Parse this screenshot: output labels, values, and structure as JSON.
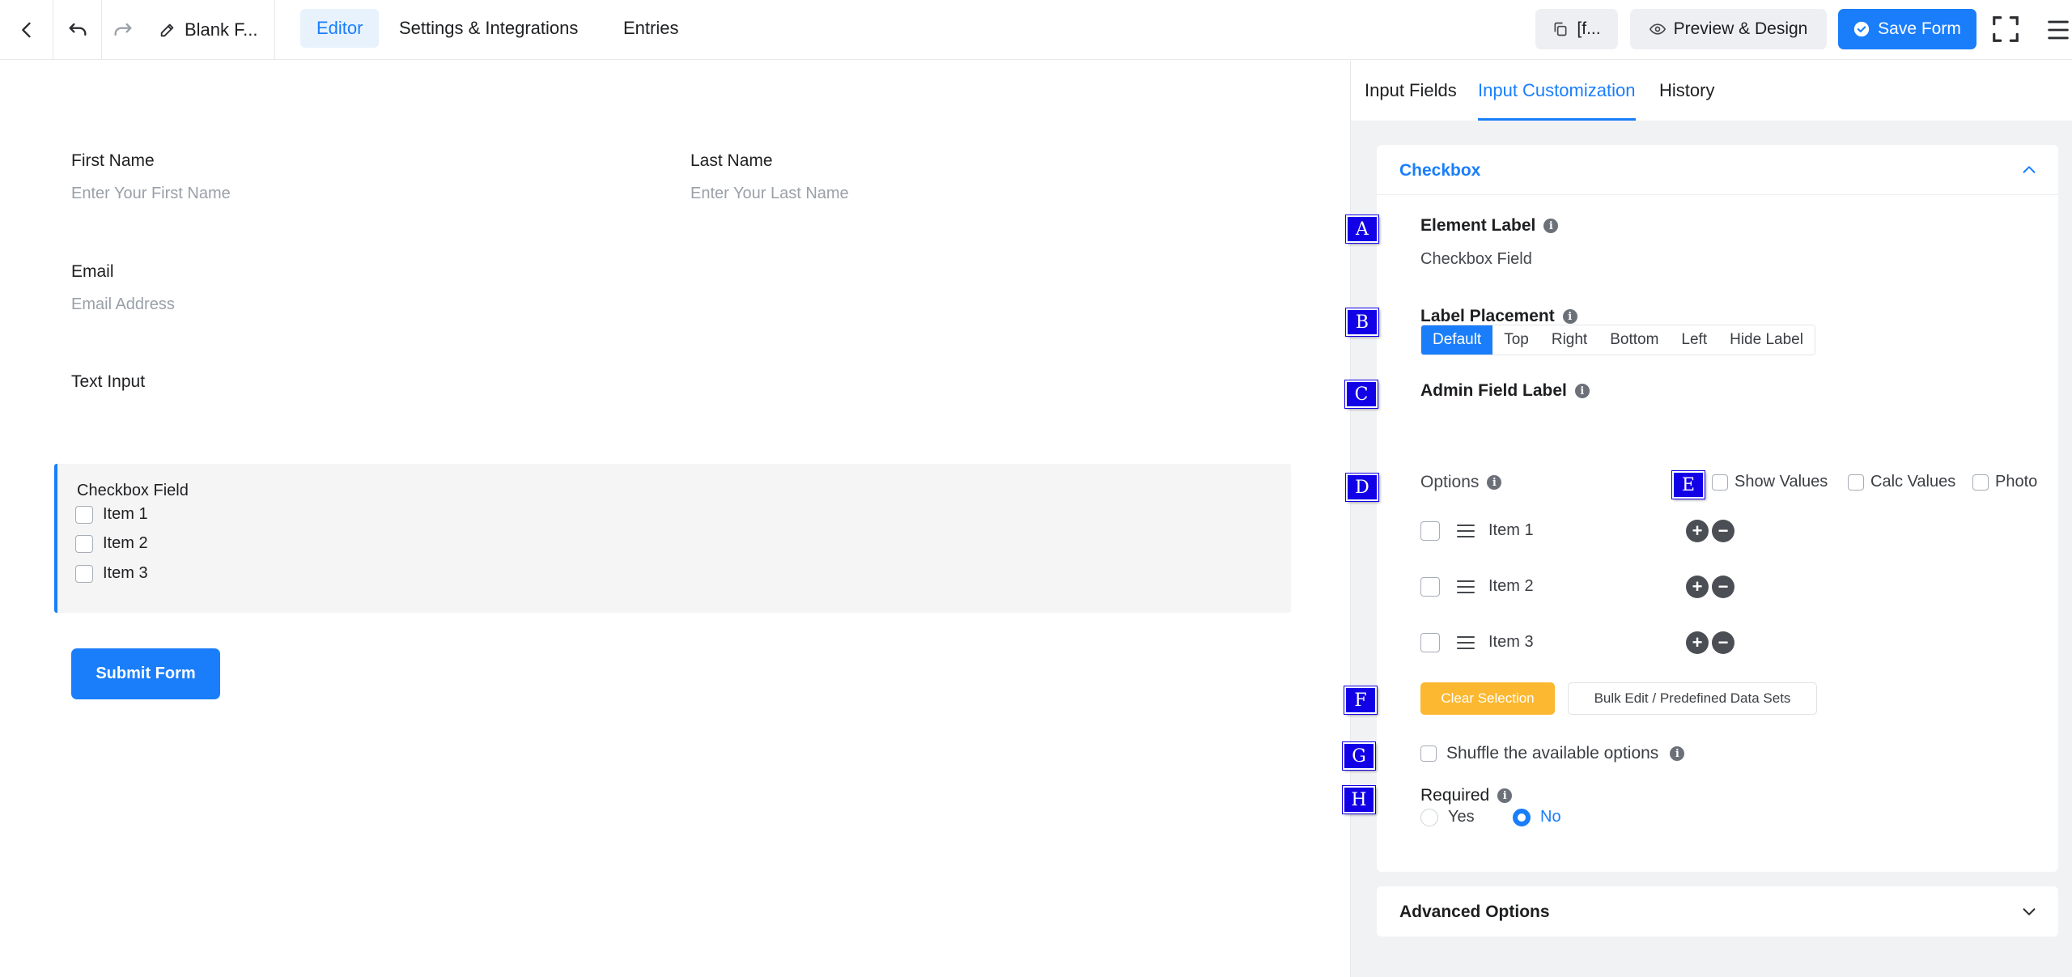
{
  "topbar": {
    "back_label": "",
    "form_title": "Blank F...",
    "tabs": [
      "Editor",
      "Settings & Integrations",
      "Entries"
    ],
    "shortcode_label": "[f...",
    "preview_label": "Preview & Design",
    "save_label": "Save Form"
  },
  "form": {
    "first_name": {
      "label": "First Name",
      "placeholder": "Enter Your First Name"
    },
    "last_name": {
      "label": "Last Name",
      "placeholder": "Enter Your Last Name"
    },
    "email": {
      "label": "Email",
      "placeholder": "Email Address"
    },
    "text_input": {
      "label": "Text Input"
    },
    "checkbox_field": {
      "label": "Checkbox Field",
      "items": [
        "Item 1",
        "Item 2",
        "Item 3"
      ]
    },
    "submit_label": "Submit Form"
  },
  "panel": {
    "tabs": [
      "Input Fields",
      "Input Customization",
      "History"
    ],
    "section_title": "Checkbox",
    "element_label": {
      "title": "Element Label",
      "value": "Checkbox Field"
    },
    "label_placement": {
      "title": "Label Placement",
      "options": [
        "Default",
        "Top",
        "Right",
        "Bottom",
        "Left",
        "Hide Label"
      ],
      "selected": "Default"
    },
    "admin_field_label": {
      "title": "Admin Field Label"
    },
    "options": {
      "title": "Options",
      "toggles": [
        "Show Values",
        "Calc Values",
        "Photo"
      ],
      "items": [
        "Item 1",
        "Item 2",
        "Item 3"
      ]
    },
    "clear_selection_label": "Clear Selection",
    "bulk_edit_label": "Bulk Edit / Predefined Data Sets",
    "shuffle_label": "Shuffle the available options",
    "required": {
      "title": "Required",
      "options": [
        "Yes",
        "No"
      ],
      "selected": "No"
    },
    "advanced_label": "Advanced Options"
  },
  "markers": [
    "A",
    "B",
    "C",
    "D",
    "E",
    "F",
    "G",
    "H"
  ],
  "colors": {
    "accent": "#1a7efb",
    "warning": "#fbb830",
    "marker": "#1200e6"
  }
}
